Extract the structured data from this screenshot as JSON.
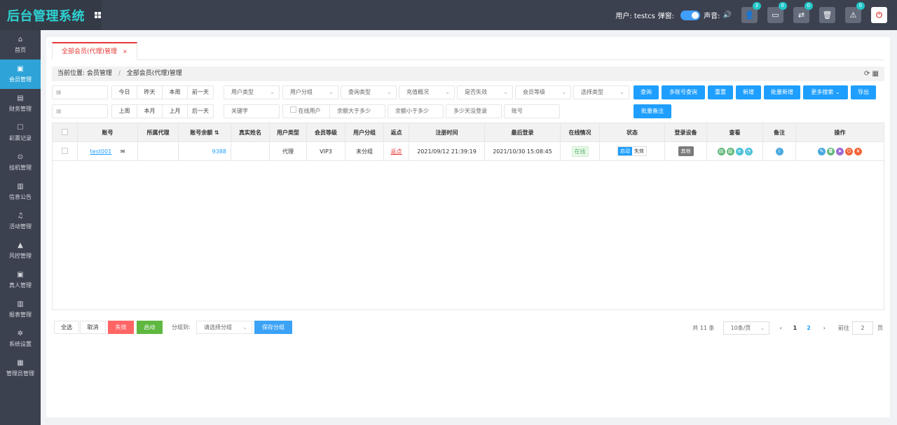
{
  "app": {
    "title": "后台管理系统"
  },
  "topbar": {
    "user_label": "用户: testcs",
    "popup_label": "弹窗:",
    "sound_label": "声音:",
    "badges": [
      "3",
      "0",
      "0",
      "",
      "",
      "0"
    ]
  },
  "sidebar": {
    "items": [
      {
        "icon": "home-icon",
        "label": "首页"
      },
      {
        "icon": "member-icon",
        "label": "会员管理"
      },
      {
        "icon": "finance-icon",
        "label": "财务管理"
      },
      {
        "icon": "lottery-icon",
        "label": "彩票记录"
      },
      {
        "icon": "hangup-icon",
        "label": "挂机管理"
      },
      {
        "icon": "notice-icon",
        "label": "信息公告"
      },
      {
        "icon": "activity-icon",
        "label": "活动管理"
      },
      {
        "icon": "risk-icon",
        "label": "风控管理"
      },
      {
        "icon": "live-icon",
        "label": "真人管理"
      },
      {
        "icon": "report-icon",
        "label": "报表管理"
      },
      {
        "icon": "settings-icon",
        "label": "系统设置"
      },
      {
        "icon": "admin-icon",
        "label": "管理员管理"
      }
    ]
  },
  "tab": {
    "label": "全部会员(代理)管理",
    "close": "×"
  },
  "breadcrumb": {
    "prefix": "当前位置:",
    "level1": "会员管理",
    "sep": "/",
    "level2": "全部会员(代理)管理"
  },
  "filters": {
    "row1_days": [
      "今日",
      "昨天",
      "本周",
      "前一天"
    ],
    "row2_days": [
      "上周",
      "本月",
      "上月",
      "后一天"
    ],
    "selects": [
      "用户类型",
      "用户分组",
      "查询类型",
      "充值概况",
      "是否失效",
      "会员等级",
      "选择类型"
    ],
    "keyword": "关键字",
    "online_user": "在线用户",
    "balance_gt": "余额大于多少",
    "balance_lt": "余额小于多少",
    "days_no_login": "多少天没登录",
    "account": "账号",
    "buttons": {
      "query": "查询",
      "multi_query": "多账号查询",
      "reset": "重置",
      "add": "新增",
      "batch_add": "批量新增",
      "more_search": "更多搜索",
      "export": "导出",
      "batch_note": "批量备注"
    }
  },
  "table": {
    "headers": [
      "账号",
      "所属代理",
      "账号余额",
      "真实姓名",
      "用户类型",
      "会员等级",
      "用户分组",
      "返点",
      "注册时间",
      "最后登录",
      "在线情况",
      "状态",
      "登录设备",
      "查看",
      "备注",
      "操作"
    ],
    "rows": [
      {
        "account": "test001",
        "agent": "",
        "balance": "9388",
        "real_name": "",
        "type": "代理",
        "level": "VIP3",
        "group": "未分组",
        "rebate": "返点",
        "reg_time": "2021/09/12 21:39:19",
        "last_login": "2021/10/30 15:08:45",
        "online": "在线",
        "status_on": "启动",
        "status_off": "失效",
        "device": "其他"
      }
    ]
  },
  "bottom": {
    "select_all": "全选",
    "cancel": "取消",
    "disable": "失效",
    "enable": "启动",
    "group_to": "分组到:",
    "group_placeholder": "请选择分组",
    "save_group": "保存分组"
  },
  "pager": {
    "total": "共 11 条",
    "page_size": "10条/页",
    "pages": [
      "1",
      "2"
    ],
    "goto_label": "前往",
    "goto_value": "2",
    "page_unit": "页"
  }
}
